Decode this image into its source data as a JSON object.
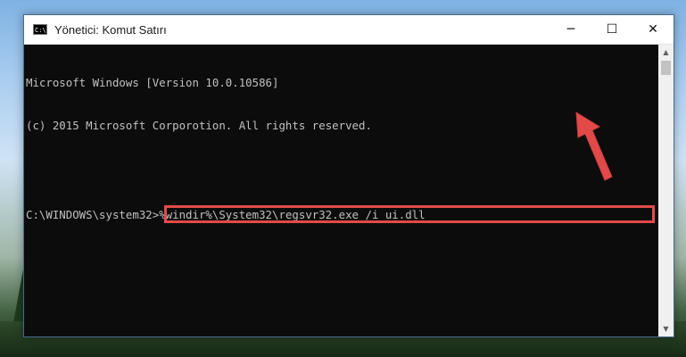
{
  "window": {
    "title": "Yönetici: Komut Satırı",
    "icon_label": "C:\\",
    "controls": {
      "minimize": "─",
      "maximize": "☐",
      "close": "✕"
    }
  },
  "console": {
    "lines": [
      "Microsoft Windows [Version 10.0.10586]",
      "(c) 2015 Microsoft Corporotion. All rights reserved.",
      ""
    ],
    "prompt": "C:\\WINDOWS\\system32>",
    "command": "%windir%\\System32\\regsvr32.exe /i ui.dll"
  },
  "scrollbar": {
    "up_icon": "▲",
    "down_icon": "▼"
  },
  "annotation": {
    "highlight_color": "#e24a4a",
    "arrow_color": "#e24a4a"
  }
}
